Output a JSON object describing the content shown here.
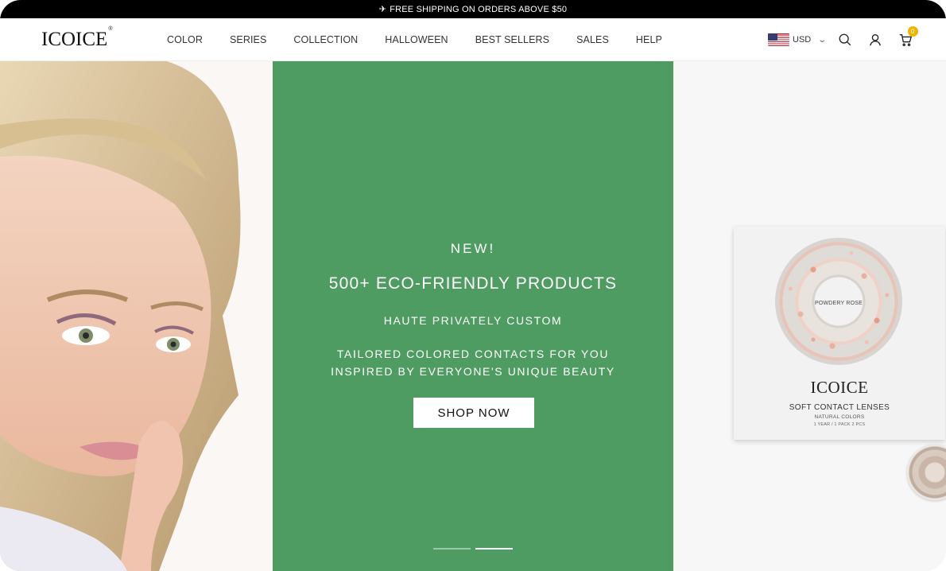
{
  "announcement": {
    "icon": "plane-icon",
    "text": "FREE SHIPPING ON ORDERS ABOVE $50"
  },
  "header": {
    "logo": "ICOICE",
    "logo_mark": "®",
    "nav": [
      {
        "label": "COLOR"
      },
      {
        "label": "SERIES"
      },
      {
        "label": "COLLECTION"
      },
      {
        "label": "HALLOWEEN"
      },
      {
        "label": "BEST SELLERS"
      },
      {
        "label": "SALES"
      },
      {
        "label": "HELP"
      }
    ],
    "currency": "USD",
    "cart_count": "0"
  },
  "hero": {
    "kicker": "NEW!",
    "title": "500+ ECO-FRIENDLY PRODUCTS",
    "subtitle": "HAUTE PRIVATELY CUSTOM",
    "line1": "TAILORED COLORED CONTACTS FOR YOU",
    "line2": "INSPIRED BY EVERYONE'S UNIQUE BEAUTY",
    "cta": "SHOP NOW",
    "slides_total": 2,
    "active_slide": 2
  },
  "product_box": {
    "ring_label": "POWDERY ROSE",
    "brand": "ICOICE",
    "line1": "SOFT CONTACT LENSES",
    "line2": "NATURAL COLORS",
    "line3": "1 YEAR  /  1 PACK 2 PCS"
  },
  "colors": {
    "hero_green": "#4e9c61",
    "badge": "#f0b400",
    "announce_bg": "#000000"
  }
}
